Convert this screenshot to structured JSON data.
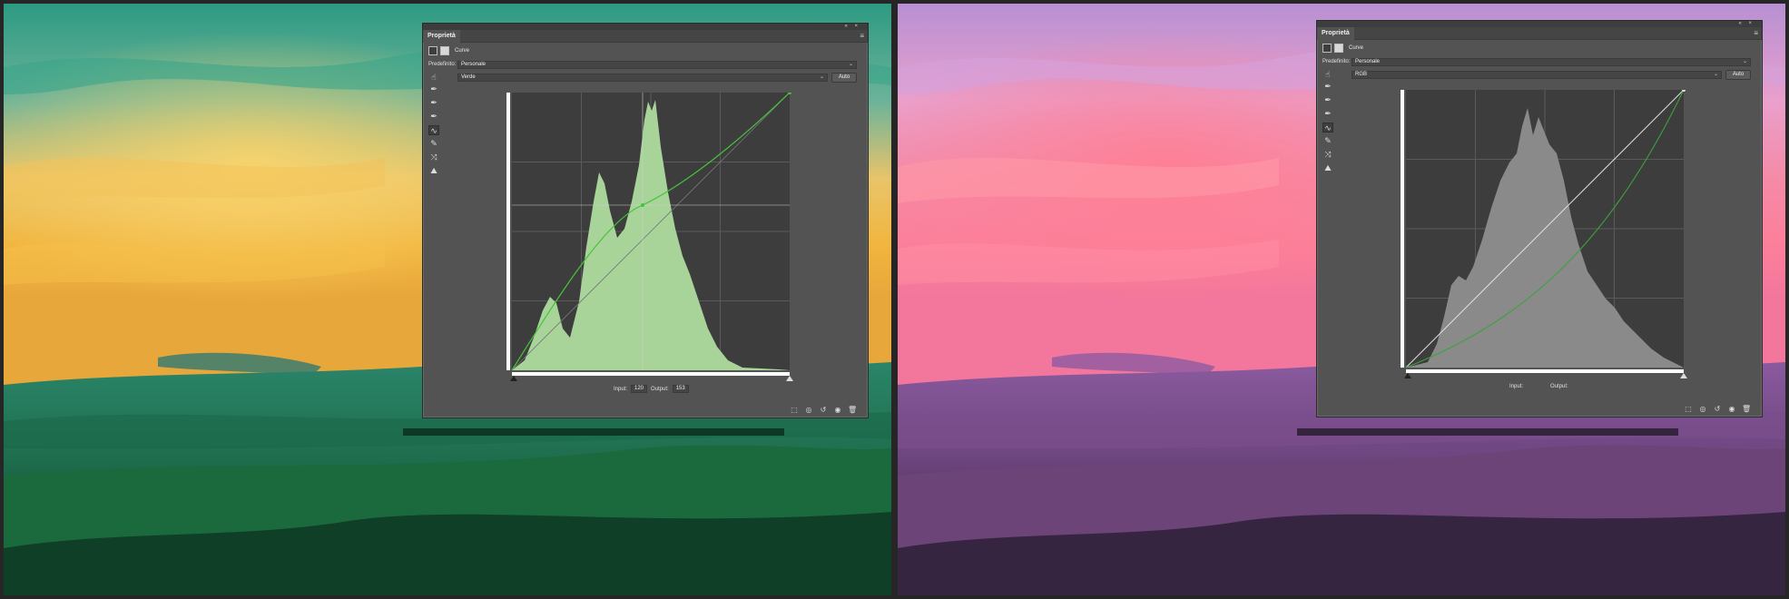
{
  "panels": {
    "left": {
      "tab_label": "Proprietà",
      "type_label": "Curve",
      "preset_label": "Predefinito:",
      "preset_value": "Personale",
      "channel_value": "Verde",
      "auto_label": "Auto",
      "input_label": "Input:",
      "input_value": "120",
      "output_label": "Output:",
      "output_value": "153",
      "histogram_fill": "#a8d49a",
      "curve_color": "#47c23a"
    },
    "right": {
      "tab_label": "Proprietà",
      "type_label": "Curve",
      "preset_label": "Predefinito:",
      "preset_value": "Personale",
      "channel_value": "RGB",
      "auto_label": "Auto",
      "input_label": "Input:",
      "output_label": "Output:",
      "histogram_fill": "#8a8a8a",
      "curve_color": "#3aa33a"
    }
  },
  "window_controls": "« ×",
  "panel_menu_icon": "≡",
  "tool_icons": [
    "target-adjust-icon",
    "black-point-eyedropper-icon",
    "gray-point-eyedropper-icon",
    "white-point-eyedropper-icon",
    "curve-points-icon",
    "pencil-icon",
    "smooth-icon",
    "clipping-warning-icon"
  ],
  "bottom_icons": [
    "clip-to-layer-icon",
    "view-previous-icon",
    "reset-icon",
    "visibility-eye-icon",
    "trash-icon"
  ],
  "colors": {
    "left_photo_tint": "#1a7a5e",
    "right_photo_tint": "#a24d9a",
    "panel_bg": "#535353"
  }
}
